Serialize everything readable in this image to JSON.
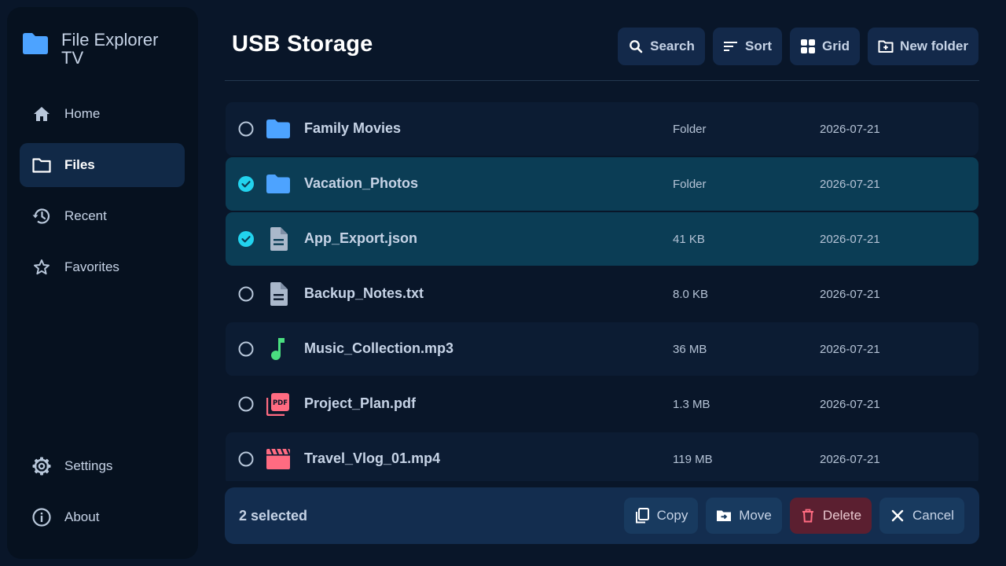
{
  "app": {
    "title": "File Explorer TV"
  },
  "sidebar": {
    "items": [
      {
        "label": "Home",
        "icon": "home-icon"
      },
      {
        "label": "Files",
        "icon": "folder-outline-icon",
        "active": true
      },
      {
        "label": "Recent",
        "icon": "history-icon"
      },
      {
        "label": "Favorites",
        "icon": "star-icon"
      },
      {
        "label": "Settings",
        "icon": "gear-icon"
      },
      {
        "label": "About",
        "icon": "info-icon"
      }
    ]
  },
  "header": {
    "title": "USB Storage"
  },
  "toolbar": {
    "search_label": "Search",
    "sort_label": "Sort",
    "grid_label": "Grid",
    "new_folder_label": "New folder"
  },
  "files": [
    {
      "name": "Family Movies",
      "type": "Folder",
      "date": "2026-07-21",
      "selected": false,
      "icon": "folder-icon"
    },
    {
      "name": "Vacation_Photos",
      "type": "Folder",
      "date": "2026-07-21",
      "selected": true,
      "icon": "folder-icon"
    },
    {
      "name": "App_Export.json",
      "type": "41 KB",
      "date": "2026-07-21",
      "selected": true,
      "icon": "document-icon"
    },
    {
      "name": "Backup_Notes.txt",
      "type": "8.0 KB",
      "date": "2026-07-21",
      "selected": false,
      "icon": "document-icon"
    },
    {
      "name": "Music_Collection.mp3",
      "type": "36 MB",
      "date": "2026-07-21",
      "selected": false,
      "icon": "music-note-icon"
    },
    {
      "name": "Project_Plan.pdf",
      "type": "1.3 MB",
      "date": "2026-07-21",
      "selected": false,
      "icon": "pdf-icon"
    },
    {
      "name": "Travel_Vlog_01.mp4",
      "type": "119 MB",
      "date": "2026-07-21",
      "selected": false,
      "icon": "video-icon"
    }
  ],
  "actionbar": {
    "selected_text": "2 selected",
    "copy_label": "Copy",
    "move_label": "Move",
    "delete_label": "Delete",
    "cancel_label": "Cancel"
  },
  "colors": {
    "background": "#091629",
    "sidebar": "#06111f",
    "accent": "#22d3ee",
    "folder": "#4da3ff",
    "selected_row": "#0b3d55",
    "danger": "#ff6b81",
    "music": "#4ade80"
  }
}
